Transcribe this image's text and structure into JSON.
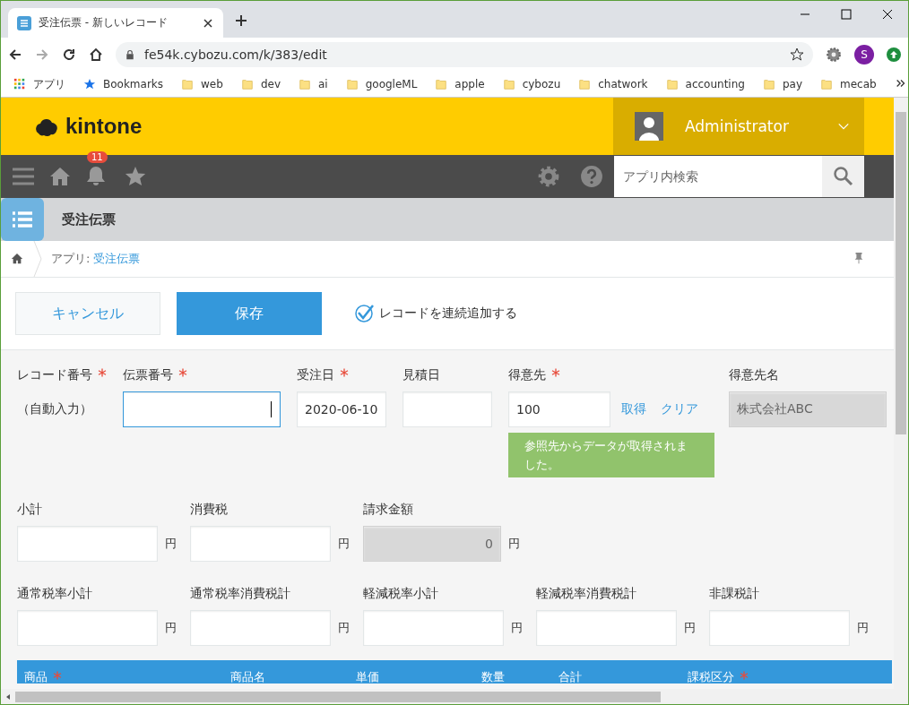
{
  "browser": {
    "tab_title": "受注伝票 - 新しいレコード",
    "url": "fe54k.cybozu.com/k/383/edit",
    "profile_initial": "S",
    "bookmarks": [
      {
        "label": "アプリ",
        "kind": "apps"
      },
      {
        "label": "Bookmarks",
        "kind": "star"
      },
      {
        "label": "web",
        "kind": "folder"
      },
      {
        "label": "dev",
        "kind": "folder"
      },
      {
        "label": "ai",
        "kind": "folder"
      },
      {
        "label": "googleML",
        "kind": "folder"
      },
      {
        "label": "apple",
        "kind": "folder"
      },
      {
        "label": "cybozu",
        "kind": "folder"
      },
      {
        "label": "chatwork",
        "kind": "folder"
      },
      {
        "label": "accounting",
        "kind": "folder"
      },
      {
        "label": "pay",
        "kind": "folder"
      },
      {
        "label": "mecab",
        "kind": "folder"
      }
    ]
  },
  "header": {
    "logo": "kintone",
    "user": "Administrator"
  },
  "nav": {
    "notification_count": "11",
    "search": {
      "placeholder": "アプリ内検索"
    }
  },
  "app": {
    "title": "受注伝票"
  },
  "breadcrumb": {
    "prefix": "アプリ:",
    "link": "受注伝票"
  },
  "actions": {
    "cancel": "キャンセル",
    "save": "保存",
    "continuous_add": {
      "label": "レコードを連続追加する",
      "checked": true
    }
  },
  "form_rows": [
    [
      {
        "label": "レコード番号",
        "required": true,
        "kind": "static",
        "value": "（自動入力）"
      },
      {
        "label": "伝票番号",
        "required": true,
        "kind": "input",
        "focused": true
      },
      {
        "label": "受注日",
        "required": true,
        "kind": "input",
        "focused": false,
        "value": "2020-06-10"
      },
      {
        "label": "見積日",
        "required": false,
        "kind": "input",
        "focused": false
      },
      {
        "label": "得意先",
        "required": true,
        "kind": "lookup",
        "value": "100",
        "links": [
          "取得",
          "クリア"
        ],
        "message": "参照先からデータが取得されました。"
      },
      {
        "label": "得意先名",
        "required": false,
        "kind": "disabled",
        "value": "株式会社ABC"
      }
    ],
    [
      {
        "label": "小計",
        "required": false,
        "kind": "input",
        "focused": false,
        "unit": "円"
      },
      {
        "label": "消費税",
        "required": false,
        "kind": "input",
        "focused": false,
        "unit": "円"
      },
      {
        "label": "請求金額",
        "required": false,
        "kind": "calc",
        "value": "0",
        "unit": "円"
      }
    ],
    [
      {
        "label": "通常税率小計",
        "required": false,
        "kind": "input",
        "focused": false,
        "unit": "円"
      },
      {
        "label": "通常税率消費税計",
        "required": false,
        "kind": "input",
        "focused": false,
        "unit": "円"
      },
      {
        "label": "軽減税率小計",
        "required": false,
        "kind": "input",
        "focused": false,
        "unit": "円"
      },
      {
        "label": "軽減税率消費税計",
        "required": false,
        "kind": "input",
        "focused": false,
        "unit": "円"
      },
      {
        "label": "非課税計",
        "required": false,
        "kind": "input",
        "focused": false,
        "unit": "円"
      }
    ]
  ],
  "table": {
    "columns": [
      {
        "label": "商品",
        "required": true
      },
      {
        "label": "商品名",
        "required": false
      },
      {
        "label": "単価",
        "required": false
      },
      {
        "label": "数量",
        "required": false
      },
      {
        "label": "合計",
        "required": false
      },
      {
        "label": "課税区分",
        "required": true
      }
    ]
  }
}
